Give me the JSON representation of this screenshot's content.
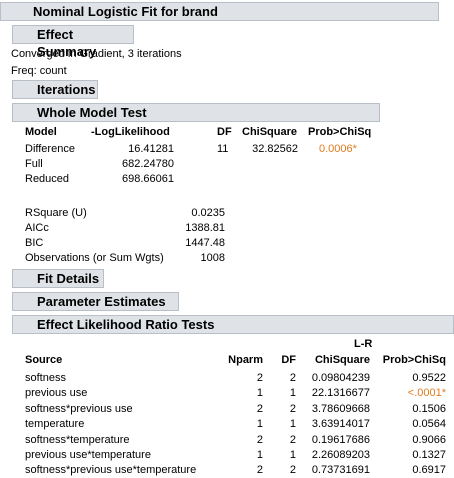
{
  "report": {
    "title": "Nominal Logistic Fit for brand",
    "effect_summary": "Effect Summary",
    "converged": "Converged in Gradient, 3 iterations",
    "freq": "Freq: count",
    "iterations": "Iterations",
    "whole_model_test": "Whole Model Test",
    "fit_details": "Fit Details",
    "parameter_estimates": "Parameter Estimates",
    "effect_lr_tests": "Effect Likelihood Ratio Tests"
  },
  "wmt": {
    "headers": {
      "model": "Model",
      "loglik": "-LogLikelihood",
      "df": "DF",
      "chisq": "ChiSquare",
      "prob": "Prob>ChiSq"
    },
    "rows": [
      {
        "model": "Difference",
        "loglik": "16.41281",
        "df": "11",
        "chisq": "32.82562",
        "prob": "0.0006*"
      },
      {
        "model": "Full",
        "loglik": "682.24780",
        "df": "",
        "chisq": "",
        "prob": ""
      },
      {
        "model": "Reduced",
        "loglik": "698.66061",
        "df": "",
        "chisq": "",
        "prob": ""
      }
    ],
    "stats": [
      {
        "label": "RSquare (U)",
        "value": "0.0235"
      },
      {
        "label": "AICc",
        "value": "1388.81"
      },
      {
        "label": "BIC",
        "value": "1447.48"
      },
      {
        "label": "Observations (or Sum Wgts)",
        "value": "1008"
      }
    ]
  },
  "lr": {
    "headers": {
      "source": "Source",
      "nparm": "Nparm",
      "df": "DF",
      "lr_top": "L-R",
      "chisq": "ChiSquare",
      "prob": "Prob>ChiSq"
    },
    "rows": [
      {
        "source": "softness",
        "nparm": "2",
        "df": "2",
        "chisq": "0.09804239",
        "prob": "0.9522"
      },
      {
        "source": "previous use",
        "nparm": "1",
        "df": "1",
        "chisq": "22.1316677",
        "prob": "<.0001*"
      },
      {
        "source": "softness*previous use",
        "nparm": "2",
        "df": "2",
        "chisq": "3.78609668",
        "prob": "0.1506"
      },
      {
        "source": "temperature",
        "nparm": "1",
        "df": "1",
        "chisq": "3.63914017",
        "prob": "0.0564"
      },
      {
        "source": "softness*temperature",
        "nparm": "2",
        "df": "2",
        "chisq": "0.19617686",
        "prob": "0.9066"
      },
      {
        "source": "previous use*temperature",
        "nparm": "1",
        "df": "1",
        "chisq": "2.26089203",
        "prob": "0.1327"
      },
      {
        "source": "softness*previous use*temperature",
        "nparm": "2",
        "df": "2",
        "chisq": "0.73731691",
        "prob": "0.6917"
      }
    ]
  },
  "colors": {
    "significant": "#e07c1e",
    "header_bg": "#dfe3e8"
  },
  "icons": [
    "disclosure-collapsed-icon",
    "disclosure-expanded-icon",
    "red-triangle-menu-icon"
  ]
}
